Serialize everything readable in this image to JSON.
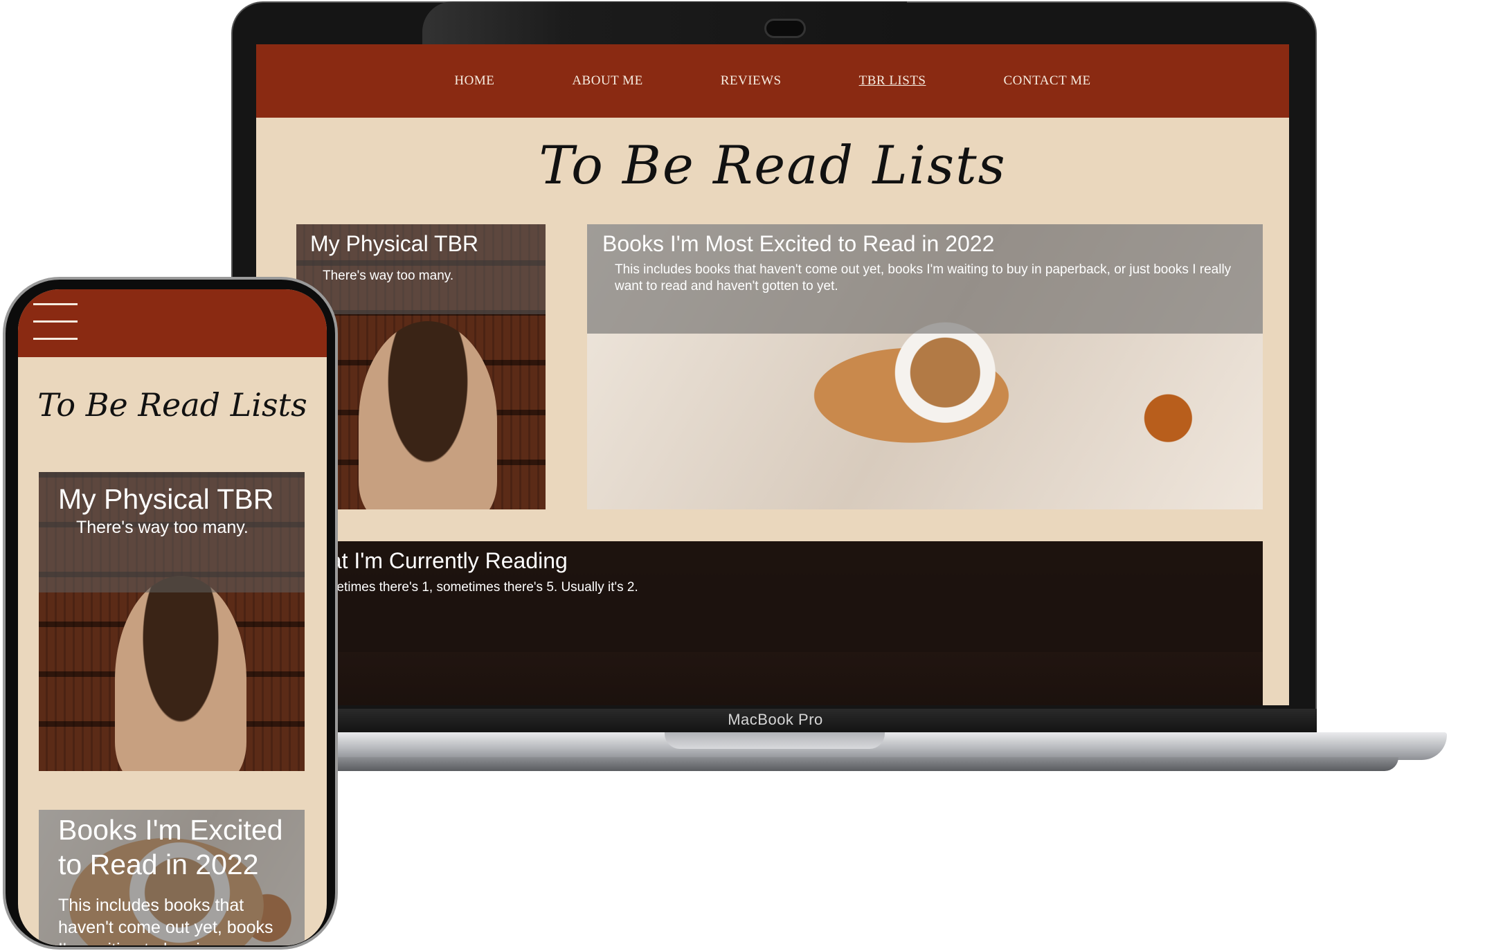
{
  "laptop": {
    "brand": "MacBook Pro",
    "nav": {
      "items": [
        {
          "label": "HOME"
        },
        {
          "label": "ABOUT ME"
        },
        {
          "label": "REVIEWS"
        },
        {
          "label": "TBR LISTS",
          "active": true
        },
        {
          "label": "CONTACT ME"
        }
      ]
    },
    "page_title": "To Be Read Lists",
    "cards": {
      "physical": {
        "title": "My Physical TBR",
        "subtitle": "There's way too many."
      },
      "excited": {
        "title": "Books I'm Most Excited to Read in 2022",
        "subtitle": "This includes books that haven't come out yet, books I'm waiting to buy in paperback, or just books I really want to read and haven't gotten to yet."
      },
      "current": {
        "title": "hat I'm Currently Reading",
        "subtitle": "ometimes there's 1, sometimes there's 5. Usually it's 2."
      }
    }
  },
  "phone": {
    "page_title": "To Be Read Lists",
    "cards": {
      "physical": {
        "title": "My Physical TBR",
        "subtitle": "There's way too many."
      },
      "excited": {
        "title_line1": "Books I'm Excited",
        "title_line2": "to Read in 2022",
        "sub_line1": "This includes books that",
        "sub_line2": "haven't come out yet, books",
        "sub_line3": "I'm waiting to buy in"
      }
    }
  },
  "colors": {
    "nav_bg": "#8a2a12",
    "page_bg": "#ead7bd",
    "nav_text": "#f6ece0"
  },
  "icons": [
    "hamburger-menu-icon",
    "camera-icon"
  ]
}
